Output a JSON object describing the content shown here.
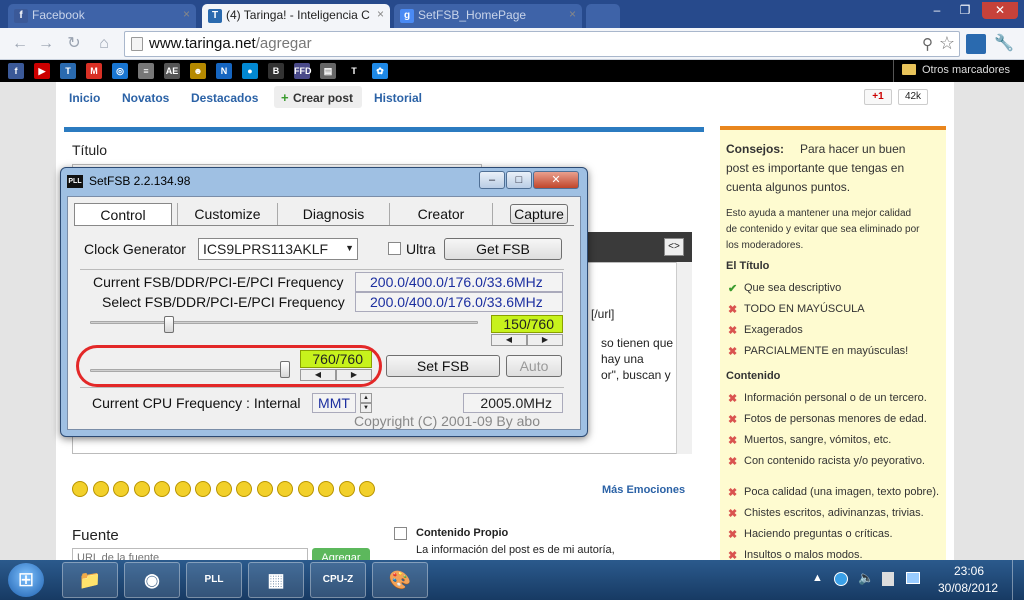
{
  "tabs": [
    {
      "title": "Facebook",
      "fav": "f",
      "color": "#3b5998",
      "active": false
    },
    {
      "title": "(4) Taringa! - Inteligencia C",
      "fav": "T",
      "color": "#2a6aaf",
      "active": true
    },
    {
      "title": "SetFSB_HomePage",
      "fav": "g",
      "color": "#4a8af4",
      "active": false
    }
  ],
  "window_controls": {
    "minimize": "–",
    "maximize": "❐",
    "close": "✕"
  },
  "address": {
    "host": "www.taringa.net",
    "path": "/agregar"
  },
  "bookmarks": {
    "items": [
      {
        "label": "f",
        "color": "#3b5998"
      },
      {
        "label": "▶",
        "color": "#cc0000"
      },
      {
        "label": "T",
        "color": "#2a6aaf"
      },
      {
        "label": "M",
        "color": "#d93025"
      },
      {
        "label": "◎",
        "color": "#1976d2"
      },
      {
        "label": "≡",
        "color": "#777"
      },
      {
        "label": "AE",
        "color": "#555"
      },
      {
        "label": "☻",
        "color": "#b58900"
      },
      {
        "label": "N",
        "color": "#1565c0"
      },
      {
        "label": "●",
        "color": "#0288d1"
      },
      {
        "label": "B",
        "color": "#333"
      },
      {
        "label": "FFD",
        "color": "#4a4a8a"
      },
      {
        "label": "▤",
        "color": "#666"
      },
      {
        "label": "T",
        "color": "#000"
      },
      {
        "label": "✿",
        "color": "#1e88e5"
      }
    ],
    "other": "Otros marcadores"
  },
  "site_nav": [
    "Inicio",
    "Novatos",
    "Destacados",
    "Crear post",
    "Historial"
  ],
  "social": {
    "gplus": "+1",
    "count": "42k"
  },
  "post": {
    "title_label": "Título",
    "right_text": [
      "[/url]",
      "so tienen que",
      "hay una",
      "or\", buscan y"
    ],
    "mas_emociones": "Más Emociones",
    "fuente_label": "Fuente",
    "url_placeholder": "URL de la fuente",
    "agregar": "Agregar",
    "contenido_propio": "Contenido Propio",
    "contenido_desc": "La información del post es de mi autoría,"
  },
  "sidebar": {
    "consejos_title": "Consejos:",
    "consejos_lines": [
      "Para hacer un buen",
      "post es importante que tengas en",
      "cuenta algunos puntos."
    ],
    "intro": [
      "Esto ayuda a mantener una mejor calidad",
      "de contenido y evitar que sea eliminado por",
      "los moderadores."
    ],
    "titulo_heading": "El Título",
    "titulo_rules": [
      {
        "ok": true,
        "text": "Que sea descriptivo"
      },
      {
        "ok": false,
        "text": "TODO EN MAYÚSCULA"
      },
      {
        "ok": false,
        "text": "Exagerados"
      },
      {
        "ok": false,
        "text": "PARCIALMENTE en mayúsculas!"
      }
    ],
    "contenido_heading": "Contenido",
    "contenido_rules": [
      "Información personal o de un tercero.",
      "Fotos de personas menores de edad.",
      "Muertos, sangre, vómitos, etc.",
      "Con contenido racista y/o peyorativo.",
      "Poca calidad (una imagen, texto pobre).",
      "Chistes escritos, adivinanzas, trivias.",
      "Haciendo preguntas o críticas.",
      "Insultos o malos modos."
    ]
  },
  "setfsb": {
    "title": "SetFSB 2.2.134.98",
    "icon": "PLL",
    "tabs": [
      "Control",
      "Customize",
      "Diagnosis",
      "Creator"
    ],
    "capture": "Capture",
    "clock_gen_label": "Clock Generator",
    "clock_gen_value": "ICS9LPRS113AKLF",
    "ultra": "Ultra",
    "get_fsb": "Get FSB",
    "current_label": "Current FSB/DDR/PCI-E/PCI Frequency",
    "current_value": "200.0/400.0/176.0/33.6MHz",
    "select_label": "Select FSB/DDR/PCI-E/PCI Frequency",
    "select_value": "200.0/400.0/176.0/33.6MHz",
    "slider1_display": "150/760",
    "slider1_fraction": 0.197,
    "slider2_display": "760/760",
    "slider2_fraction": 1.0,
    "set_fsb": "Set FSB",
    "auto": "Auto",
    "cpu_label": "Current CPU Frequency : Internal",
    "mmt": "MMT",
    "cpu_value": "2005.0MHz",
    "copyright": "Copyright (C) 2001-09 By abo"
  },
  "taskbar": {
    "start": "⊞",
    "apps": [
      {
        "name": "explorer",
        "glyph": "📁"
      },
      {
        "name": "chrome",
        "glyph": "◉"
      },
      {
        "name": "setfsb",
        "glyph": "PLL"
      },
      {
        "name": "winrar",
        "glyph": "▦"
      },
      {
        "name": "cpu-z",
        "glyph": "CPU-Z"
      },
      {
        "name": "paint",
        "glyph": "🎨"
      }
    ],
    "time": "23:06",
    "date": "30/08/2012"
  }
}
